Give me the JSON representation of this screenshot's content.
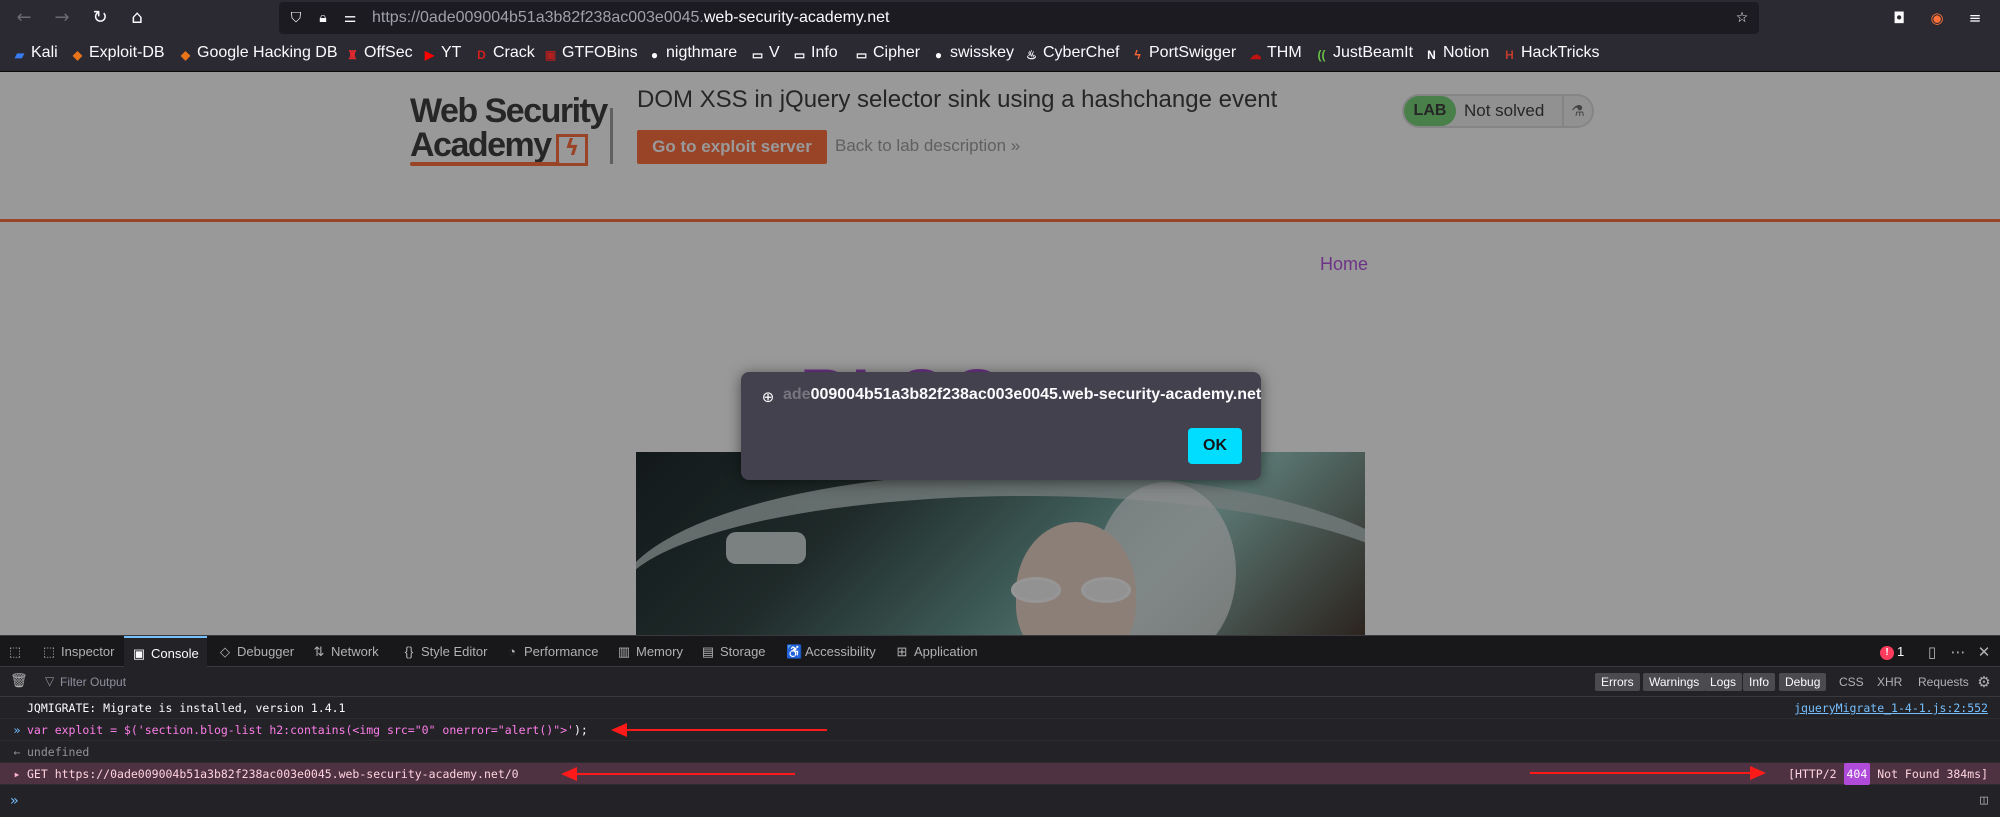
{
  "browser": {
    "url_prefix": "https://0ade009004b51a3b82f238ac003e0045.",
    "url_domain": "web-security-academy.net",
    "bookmarks": [
      {
        "label": "Kali",
        "icon": "kali-icon",
        "color": "#367bf0"
      },
      {
        "label": "Exploit-DB",
        "icon": "exploit-db-icon",
        "color": "#e8741a"
      },
      {
        "label": "Google Hacking DB",
        "icon": "ghdb-icon",
        "color": "#e8741a"
      },
      {
        "label": "OffSec",
        "icon": "offsec-icon",
        "color": "#e0282e"
      },
      {
        "label": "YT",
        "icon": "youtube-icon",
        "color": "#ff0000"
      },
      {
        "label": "Crack",
        "icon": "crack-icon",
        "color": "#d71e1e"
      },
      {
        "label": "GTFOBins",
        "icon": "gtfobins-icon",
        "color": "#b21f1f"
      },
      {
        "label": "nigthmare",
        "icon": "github-icon",
        "color": "#fbfbfe"
      },
      {
        "label": "V",
        "icon": "folder-icon",
        "color": "#fbfbfe"
      },
      {
        "label": "Info",
        "icon": "folder-icon",
        "color": "#fbfbfe"
      },
      {
        "label": "Cipher",
        "icon": "folder-icon",
        "color": "#fbfbfe"
      },
      {
        "label": "swisskey",
        "icon": "github-icon",
        "color": "#fbfbfe"
      },
      {
        "label": "CyberChef",
        "icon": "chef-icon",
        "color": "#fbfbfe"
      },
      {
        "label": "PortSwigger",
        "icon": "portswigger-icon",
        "color": "#ff6633"
      },
      {
        "label": "THM",
        "icon": "thm-icon",
        "color": "#c11111"
      },
      {
        "label": "JustBeamIt",
        "icon": "justbeamit-icon",
        "color": "#68c147"
      },
      {
        "label": "Notion",
        "icon": "notion-icon",
        "color": "#fbfbfe"
      },
      {
        "label": "HackTricks",
        "icon": "hacktricks-icon",
        "color": "#c0392b"
      }
    ]
  },
  "page": {
    "logo_line1": "Web Security",
    "logo_line2": "Academy",
    "lab_title": "DOM XSS in jQuery selector sink using a hashchange event",
    "exploit_button": "Go to exploit server",
    "back_link": "Back to lab description",
    "back_chevron": "»",
    "lab_badge": "LAB",
    "lab_status": "Not solved",
    "home_link": "Home",
    "blog_heading": "BLOG",
    "accent_color": "#ff6633"
  },
  "alert": {
    "origin_faded": "ade",
    "origin": "009004b51a3b82f238ac003e0045.web-security-academy.net",
    "ok_label": "OK"
  },
  "devtools": {
    "tabs": [
      {
        "label": "Inspector",
        "icon": "inspector-icon",
        "glyph": "⬚"
      },
      {
        "label": "Console",
        "icon": "console-icon",
        "glyph": "▣"
      },
      {
        "label": "Debugger",
        "icon": "debugger-icon",
        "glyph": "◇"
      },
      {
        "label": "Network",
        "icon": "network-icon",
        "glyph": "⇅"
      },
      {
        "label": "Style Editor",
        "icon": "style-editor-icon",
        "glyph": "{}"
      },
      {
        "label": "Performance",
        "icon": "performance-icon",
        "glyph": "◔"
      },
      {
        "label": "Memory",
        "icon": "memory-icon",
        "glyph": "▥"
      },
      {
        "label": "Storage",
        "icon": "storage-icon",
        "glyph": "▤"
      },
      {
        "label": "Accessibility",
        "icon": "accessibility-icon",
        "glyph": "♿"
      },
      {
        "label": "Application",
        "icon": "application-icon",
        "glyph": "⊞"
      }
    ],
    "active_tab": "Console",
    "error_count": "1",
    "filter_placeholder": "Filter Output",
    "filters": [
      "Errors",
      "Warnings",
      "Logs",
      "Info",
      "Debug"
    ],
    "filters_plain": [
      "CSS",
      "XHR",
      "Requests"
    ],
    "console": {
      "line1_text": "JQMIGRATE: Migrate is installed, version 1.4.1",
      "line1_source": "jqueryMigrate_1-4-1.js:2:552",
      "line2_prefix": "var exploit = $(",
      "line2_string": "'section.blog-list h2:contains(<img src=\"0\" onerror=\"alert()\">'",
      "line2_suffix": ");",
      "line3_text": "undefined",
      "line4_method": "GET",
      "line4_url": "https://0ade009004b51a3b82f238ac003e0045.web-security-academy.net/0",
      "line4_status_prefix": "[HTTP/2",
      "line4_status_code": "404",
      "line4_status_suffix": "Not Found 384ms]"
    }
  }
}
